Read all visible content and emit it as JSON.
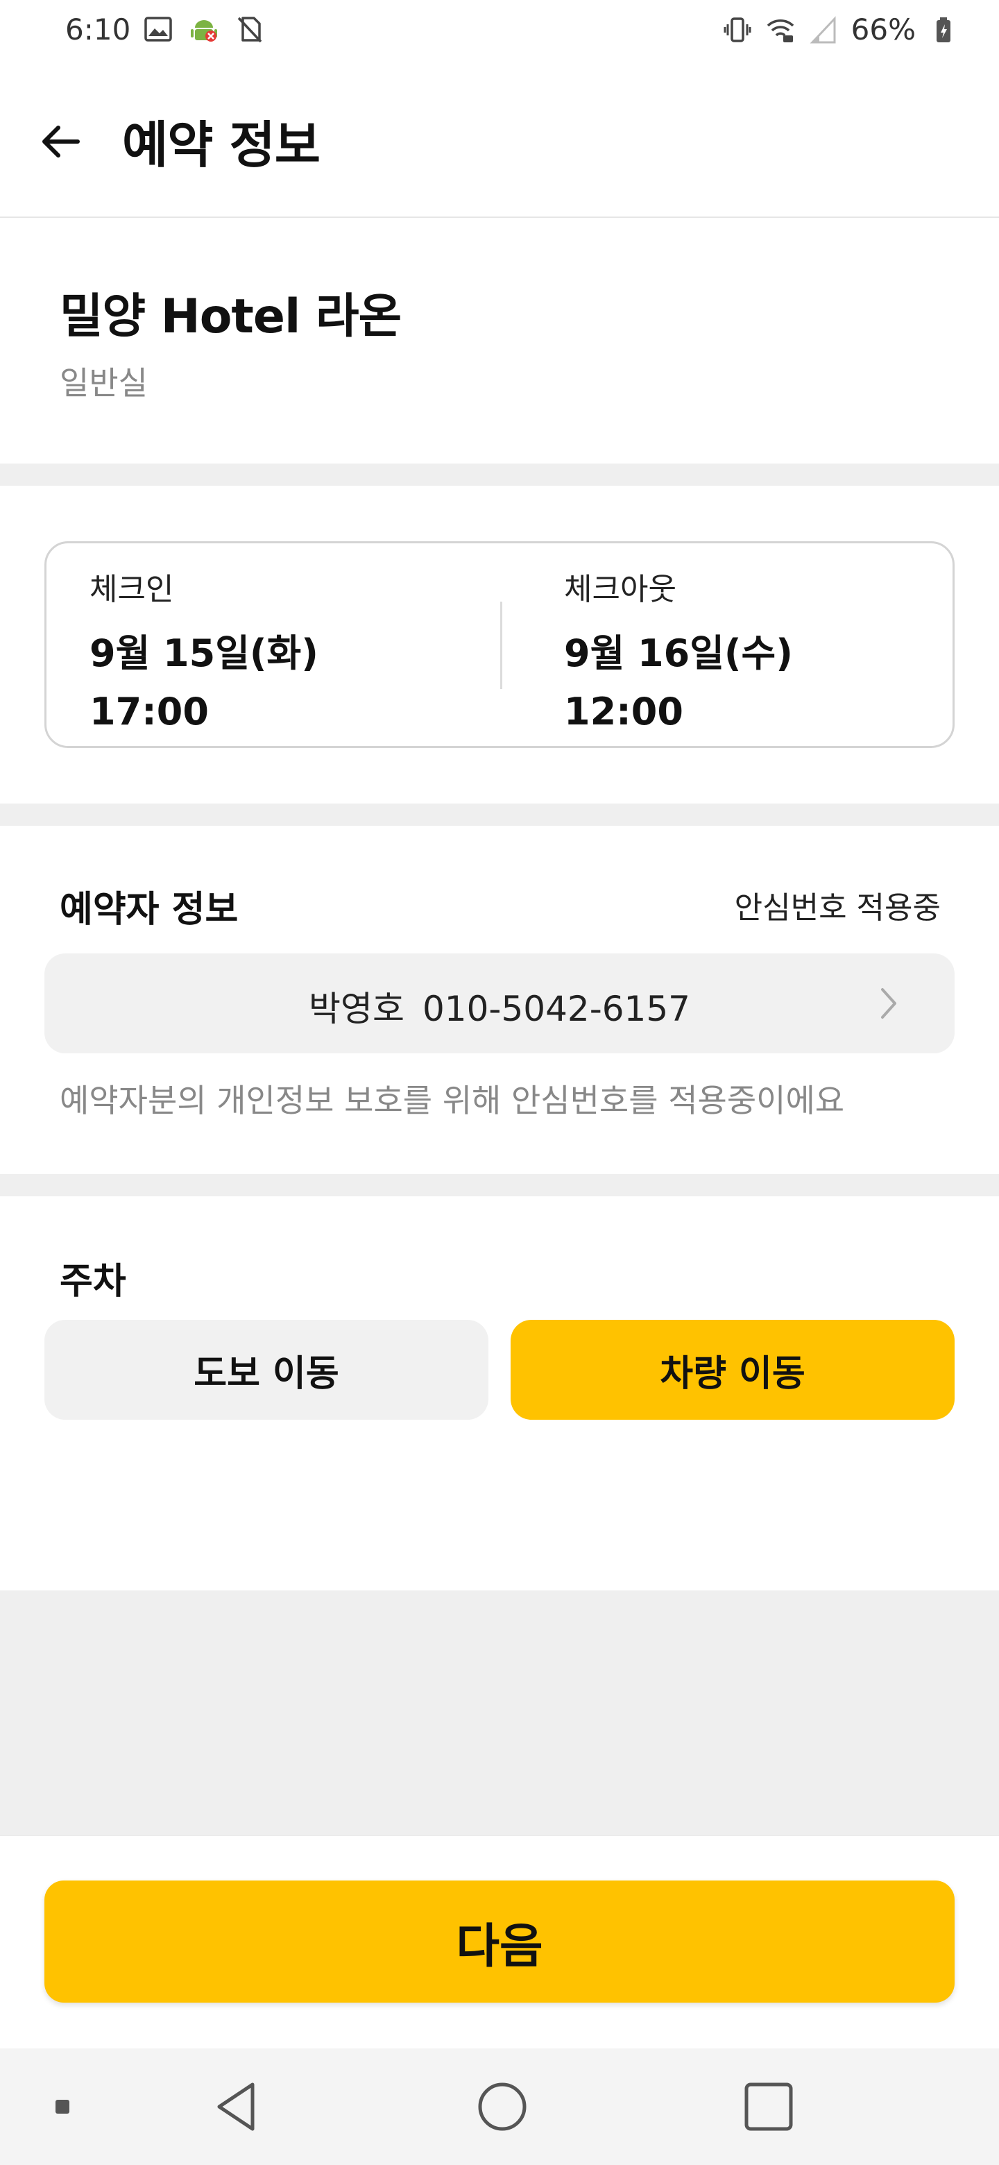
{
  "status_bar": {
    "time": "6:10",
    "battery": "66%",
    "icons": [
      "image-icon",
      "android-debug-icon",
      "no-sim-icon",
      "vibrate-icon",
      "wifi-icon",
      "signal-icon",
      "battery-icon"
    ]
  },
  "header": {
    "title": "예약 정보",
    "back_icon": "arrow-left-icon"
  },
  "hotel": {
    "name": "밀양 Hotel 라온",
    "room_type": "일반실"
  },
  "stay": {
    "checkin_label": "체크인",
    "checkin_date": "9월 15일(화)",
    "checkin_time": "17:00",
    "checkout_label": "체크아웃",
    "checkout_date": "9월 16일(수)",
    "checkout_time": "12:00"
  },
  "booker": {
    "title": "예약자 정보",
    "safe_number_label": "안심번호 적용중",
    "name": "박영호",
    "phone": "010-5042-6157",
    "privacy_note": "예약자분의 개인정보 보호를 위해 안심번호를 적용중이에요"
  },
  "parking": {
    "title": "주차",
    "options": [
      {
        "label": "도보 이동",
        "selected": false
      },
      {
        "label": "차량 이동",
        "selected": true
      }
    ]
  },
  "footer": {
    "next_label": "다음"
  },
  "colors": {
    "accent": "#ffc200",
    "field_bg": "#f1f1f1",
    "section_divider": "#efefef",
    "muted_text": "#888888"
  }
}
